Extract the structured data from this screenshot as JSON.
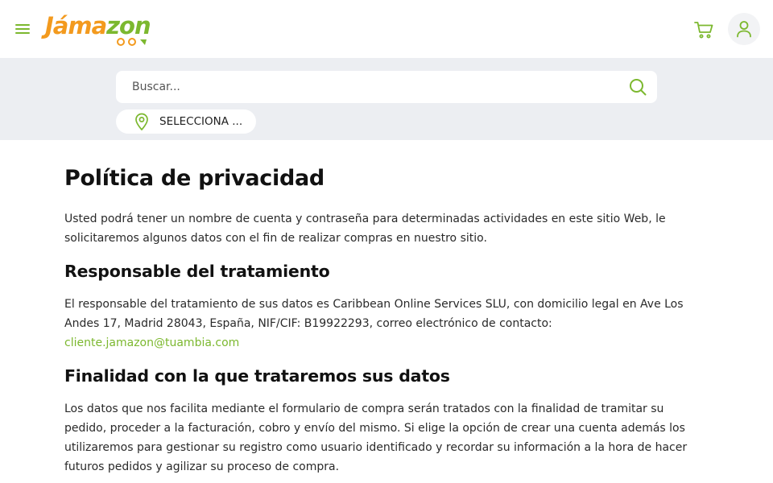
{
  "header": {
    "logo": {
      "part1": "Jáma",
      "part2": "zon"
    },
    "menu_icon": "hamburger-menu-icon",
    "cart_icon": "shopping-cart-icon",
    "user_icon": "user-icon"
  },
  "search": {
    "placeholder": "Buscar...",
    "icon": "search-icon",
    "location_label": "SELECCIONA ..."
  },
  "colors": {
    "brand_orange": "#f39a1e",
    "brand_green": "#7cb82f",
    "search_band": "#eceef2"
  },
  "article": {
    "title": "Política de privacidad",
    "intro": "Usted podrá tener un nombre de cuenta y contraseña para determinadas actividades en este sitio Web, le solicitaremos algunos datos con el fin de realizar compras en nuestro sitio.",
    "section1": {
      "heading": "Responsable del tratamiento",
      "text": "El responsable del tratamiento de sus datos es Caribbean Online Services SLU, con domicilio legal en Ave Los Andes 17, Madrid 28043, España, NIF/CIF: B19922293, correo electrónico de contacto:",
      "email": "cliente.jamazon@tuambia.com"
    },
    "section2": {
      "heading": "Finalidad con la que trataremos sus datos",
      "text": "Los datos que nos facilita mediante el formulario de compra serán tratados con la finalidad de tramitar su pedido, proceder a la facturación, cobro y envío del mismo. Si elige la opción de crear una cuenta además los utilizaremos para gestionar su registro como usuario identificado y recordar su información a la hora de hacer futuros pedidos y agilizar su proceso de compra."
    }
  }
}
